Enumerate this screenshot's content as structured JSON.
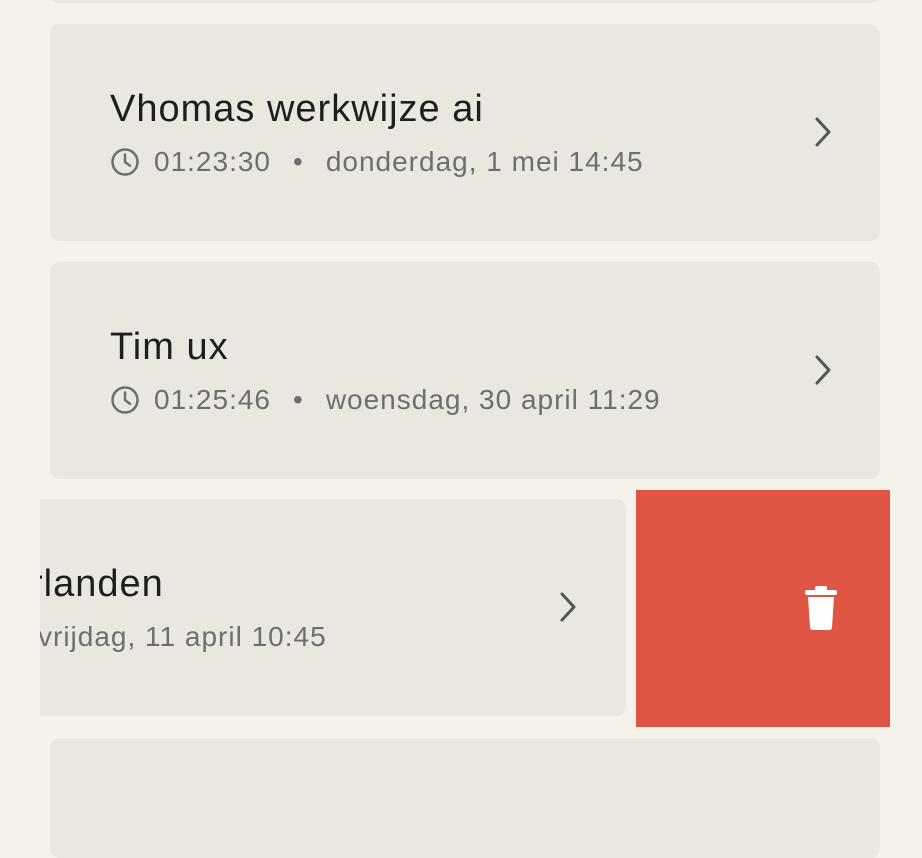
{
  "recordings": [
    {
      "title": "Vhomas werkwijze ai",
      "duration": "01:23:30",
      "separator": "•",
      "date": "donderdag, 1 mei 14:45"
    },
    {
      "title": "Tim ux",
      "duration": "01:25:46",
      "separator": "•",
      "date": "woensdag, 30 april 11:29"
    },
    {
      "title_visible": "rlanden",
      "date_visible": "vrijdag, 11 april 10:45"
    }
  ],
  "actions": {
    "delete_color": "#e05444",
    "delete_icon": "trash-icon"
  },
  "icons": {
    "duration": "clock-icon",
    "open": "chevron-right-icon"
  }
}
